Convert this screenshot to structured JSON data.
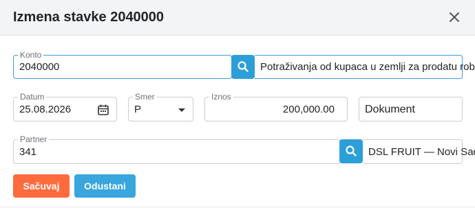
{
  "modal": {
    "title": "Izmena stavke 2040000"
  },
  "form": {
    "konto": {
      "label": "Konto",
      "value": "2040000",
      "description": "Potraživanja od kupaca u zemlji za prodatu robu"
    },
    "datum": {
      "label": "Datum",
      "value": "25.08.2026"
    },
    "smer": {
      "label": "Smer",
      "value": "P"
    },
    "iznos": {
      "label": "Iznos",
      "value": "200,000.00"
    },
    "dokument": {
      "value": "Dokument"
    },
    "partner": {
      "label": "Partner",
      "value": "341",
      "description": "DSL FRUIT — Novi Sad"
    }
  },
  "buttons": {
    "save": "Sačuvaj",
    "cancel": "Odustani"
  },
  "colors": {
    "accent": "#2c9fd8",
    "save": "#ff6b3d",
    "cancel": "#3aa6de"
  },
  "icons": [
    "close-icon",
    "search-icon",
    "calendar-icon",
    "caret-down-icon"
  ]
}
